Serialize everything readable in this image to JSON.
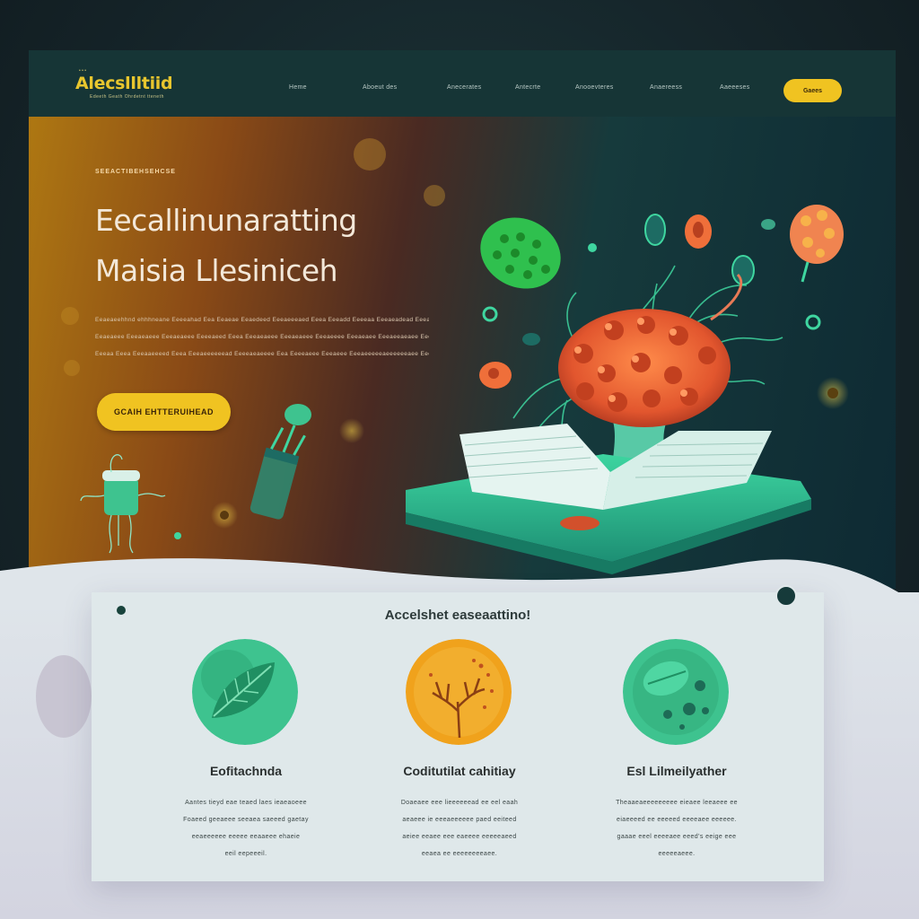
{
  "brand": {
    "logo_text": "Alecsllltiid",
    "logo_tagline": "Edeeth Geath Ohrdetnt tteneth"
  },
  "nav": {
    "items": [
      "Heme",
      "Aboeut des",
      "Anecerates",
      "Antecrte",
      "Anooevteres",
      "Anaereess",
      "Aaeeeses"
    ],
    "cta_label": "Gaees"
  },
  "hero": {
    "eyebrow": "SEEACTIBEHSEHCSE",
    "title_lines": [
      "Eecallinunaratting",
      "Maisia Llesiniceh"
    ],
    "body_lines": [
      "Eeaeaeehhnd ehhhneane Eeeeahad Eea Eeaeae Eeaedeed Eeeaeeeaed Eeea Eeeadd Eeeeaa Eeeaeadead Eeea Eeeaeaen",
      "Eeaeaeee Eeeaeaeee Eeeaeaeee Eeeeaeed Eeea Eeeaeaeee Eeeaeaeee Eeeaeeee Eeeaeaee Eeeaeeaeaee Eeeaeaeeaaeee",
      "Eeeaa Eeea Eeeaaeeeed Eeea Eeeaeeeeeead Eeeeaeaeeee Eea Eeeeaeee Eeeaeee Eeeaeeeeeaeeeeeeaee Eeeeaea"
    ],
    "cta_label": "GCAIH EHTTERUIHEAD"
  },
  "features": {
    "title": "Accelshet easeaattino!",
    "cards": [
      {
        "title": "Eofitachnda",
        "body_lines": [
          "Aantes tieyd eae teaed laes ieaeaoeee",
          "Foaeed geeaeee seeaea saeeed gaetay",
          "eeaeeeeee eeeee eeaaeee ehaeie",
          "eeil eepeeeil."
        ]
      },
      {
        "title": "Coditutilat cahitiay",
        "body_lines": [
          "Doaeaee eee lieeeeeead ee eel eaah",
          "aeaeee ie eeeaeeeeee paed eeiteed",
          "aeiee eeaee eee eaeeee eeeeeaeed",
          "eeaea ee eeeeeeeeaee."
        ]
      },
      {
        "title": "Esl Lilmeilyather",
        "body_lines": [
          "Theaaeaeeeeeeeee eieaee leeaeee ee",
          "eiaeeeed ee eeeeed eeeeaee eeeeee.",
          "gaaae eeel eeeeaee eeed's eeige eee",
          "eeeeeaeee."
        ]
      }
    ]
  },
  "colors": {
    "accent_yellow": "#f0c321",
    "teal_dark": "#163536",
    "mint": "#3ec38f",
    "coral": "#e8673a",
    "orange": "#f0a21c"
  }
}
